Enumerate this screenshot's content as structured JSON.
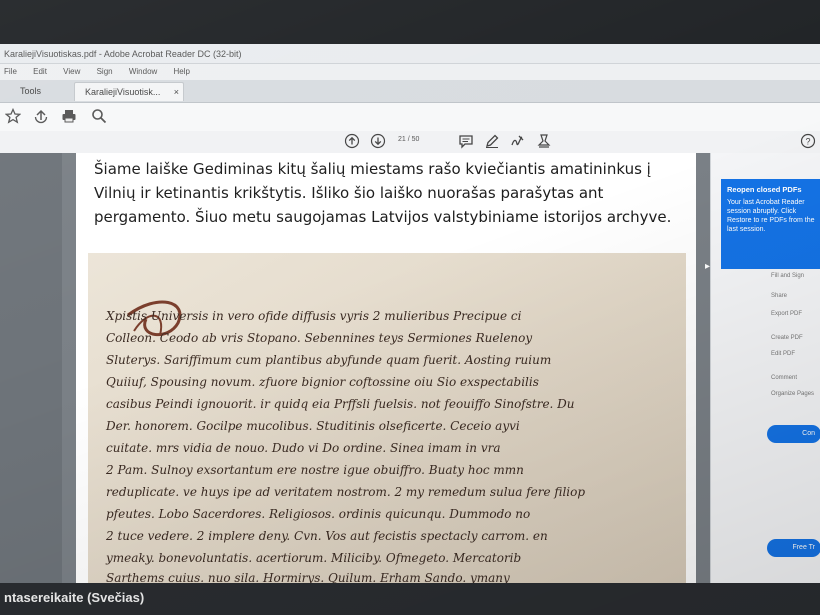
{
  "window": {
    "title": "KaraliejiVisuotiskas.pdf - Adobe Acrobat Reader DC (32-bit)",
    "menu": [
      "File",
      "Edit",
      "View",
      "Sign",
      "Window",
      "Help"
    ]
  },
  "tabs": {
    "tools_label": "Tools",
    "document_label": "KaraliejiVisuotisk...",
    "close_glyph": "×"
  },
  "toolbar_icons": [
    "star-icon",
    "upload-icon",
    "print-icon",
    "search-icon"
  ],
  "navigation": {
    "page_display": "21 / 50",
    "icons": [
      "page-up-icon",
      "page-down-icon",
      "comment-icon",
      "pen-icon",
      "sign-icon",
      "stamp-icon",
      "help-icon"
    ]
  },
  "document": {
    "paragraph": "Šiame laiške Gediminas kitų šalių miestams rašo kviečiantis amatininkus į Vilnių ir ketinantis krikštytis. Išliko šio laiško nuorašas parašytas ant pergamento. Šiuo metu saugojamas Latvijos valstybiniame istorijos archyve.",
    "manuscript_lines": [
      "Xpistis Universis in vero ofide diffusis vyris 2 mulieribus Precipue ci",
      "Colleon. Ceodo ab vris Stopano. Sebennines teys Sermiones Ruelenoy",
      "Sluterys. Sariffimum cum plantibus abyfunde quam fuerit. Aosting ruium",
      "Quiiuf, Spousing novum. zfuore bignior coftossine oiu Sio exspectabilis",
      "casibus Peindi ignouorit. ir quidq eia Prffsli fuelsis. not feouiffo Sinofstre. Du",
      "Der. honorem. Gocilpe mucolibus. Studitinis olseficerte. Ceceio ayvi",
      "cuitate. mrs vidia de nouo. Dudo vi Do ordine. Sinea imam in vra",
      "2 Pam. Sulnoy exsortantum ere nostre igue obuiffro. Buaty hoc mmn",
      "reduplicate. ve huys ipe ad veritatem nostrom. 2 my remedum sulua fere filiop",
      "pfeutes. Lobo Sacerdores. Religiosos. ordinis quicunqu. Dummodo no",
      "2 tuce vedere. 2 implere deny. Cvn. Vos aut fecistis spectacly carrom. en",
      "ymeaky. bonevoluntatis. acertiorum. Miliciby. Ofmegeto. Mercatorib",
      "Sarthems cuius. nuo sila. Hormirys. Quilum. Erham Sando. ymany"
    ]
  },
  "right_panel": {
    "reopen_title": "Reopen closed PDFs",
    "reopen_body": "Your last Acrobat Reader session abruptly. Click Restore to re PDFs from the last session.",
    "items": [
      "Fill and Sign",
      "Share",
      "Export PDF",
      "Create PDF",
      "Edit PDF",
      "Comment",
      "Organize Pages"
    ],
    "button_1": "Con",
    "button_2": "Free Tr"
  },
  "footer": {
    "participant_name": "ntasereikaite (Svečias)"
  }
}
